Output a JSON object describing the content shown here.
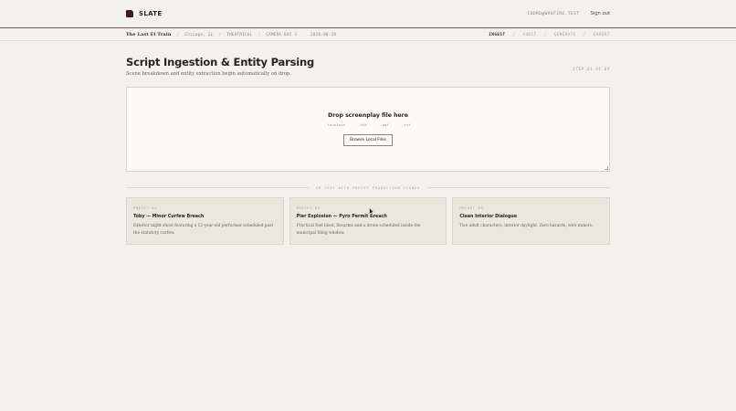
{
  "app": {
    "name": "SLATE"
  },
  "user": {
    "email": "COORD@WAVFIRE.TEST",
    "signout_label": "Sign out"
  },
  "project": {
    "title": "The Last El Train",
    "location": "Chicago, IL",
    "release": "THEATRICAL",
    "camera_day": "CAMERA DAY 3",
    "date": "2026-06-18"
  },
  "steps": [
    {
      "label": "INGEST",
      "active": true
    },
    {
      "label": "AUDIT",
      "active": false
    },
    {
      "label": "GENERATE",
      "active": false
    },
    {
      "label": "EXPORT",
      "active": false
    }
  ],
  "page": {
    "title": "Script Ingestion & Entity Parsing",
    "subtitle": "Scene breakdown and entity extraction begin automatically on drop.",
    "step_counter": "STEP 01 OF 04"
  },
  "dropzone": {
    "title": "Drop screenplay file here",
    "formats": [
      ".fountain",
      ".fdx",
      ".pdf",
      ".txt"
    ],
    "button_label": "Browse Local Files"
  },
  "presets_label": "OR TEST WITH PRESET PRODUCTION SCENES",
  "presets": [
    {
      "tag": "PRESET 01",
      "title": "Toby — Minor Curfew Breach",
      "desc": "Exterior night shoot featuring a 12-year-old performer scheduled past the statutory curfew."
    },
    {
      "tag": "PRESET 02",
      "title": "Pier Explosion — Pyro Permit Breach",
      "desc": "Practical fuel blast, firearms and a drone scheduled inside the municipal filing window."
    },
    {
      "tag": "PRESET 03",
      "title": "Clean Interior Dialogue",
      "desc": "Two adult characters, interior daylight. Zero hazards, zero minors."
    }
  ]
}
